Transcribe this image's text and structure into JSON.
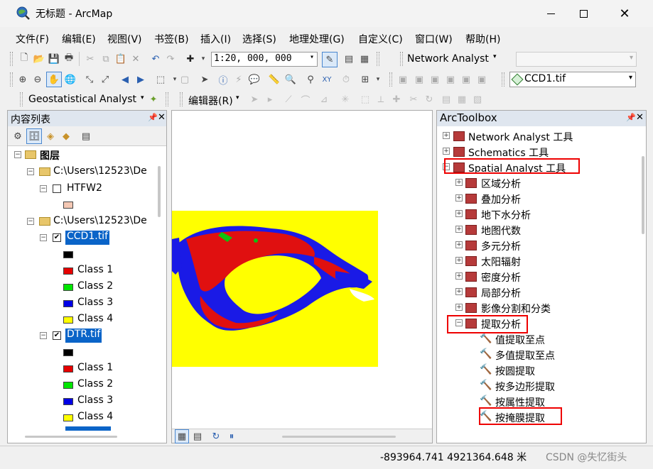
{
  "window": {
    "title": "无标题 - ArcMap",
    "min_icon": "minimize-icon",
    "max_icon": "maximize-icon",
    "close_icon": "close-icon"
  },
  "menu": [
    "文件(F)",
    "编辑(E)",
    "视图(V)",
    "书签(B)",
    "插入(I)",
    "选择(S)",
    "地理处理(G)",
    "自定义(C)",
    "窗口(W)",
    "帮助(H)"
  ],
  "toolbar": {
    "scale": "1:20, 000, 000",
    "network_analyst": "Network Analyst",
    "layer_select": "CCD1.tif",
    "geostat": "Geostatistical Analyst",
    "editor": "编辑器(R)"
  },
  "toc": {
    "title": "内容列表",
    "root": "图层",
    "groups": [
      {
        "label": "C:\\Users\\12523\\De",
        "layers": [
          {
            "name": "HTFW2",
            "checked": false,
            "legend": [
              {
                "color": "#f4c8b4",
                "label": ""
              }
            ]
          }
        ]
      },
      {
        "label": "C:\\Users\\12523\\De",
        "layers": [
          {
            "name": "CCD1.tif",
            "checked": true,
            "legend": [
              {
                "color": "#000000",
                "label": ""
              },
              {
                "color": "#e60000",
                "label": "Class 1"
              },
              {
                "color": "#00e600",
                "label": "Class 2"
              },
              {
                "color": "#0000e6",
                "label": "Class 3"
              },
              {
                "color": "#ffff00",
                "label": "Class 4"
              }
            ]
          },
          {
            "name": "DTR.tif",
            "checked": true,
            "legend": [
              {
                "color": "#000000",
                "label": ""
              },
              {
                "color": "#e60000",
                "label": "Class 1"
              },
              {
                "color": "#00e600",
                "label": "Class 2"
              },
              {
                "color": "#0000e6",
                "label": "Class 3"
              },
              {
                "color": "#ffff00",
                "label": "Class 4"
              }
            ]
          }
        ]
      }
    ]
  },
  "arctoolbox": {
    "title": "ArcToolbox",
    "toolboxes": [
      "Network Analyst 工具",
      "Schematics 工具",
      "Spatial Analyst 工具"
    ],
    "spatial_children": [
      "区域分析",
      "叠加分析",
      "地下水分析",
      "地图代数",
      "多元分析",
      "太阳辐射",
      "密度分析",
      "局部分析",
      "影像分割和分类",
      "提取分析"
    ],
    "extract_tools": [
      "值提取至点",
      "多值提取至点",
      "按圆提取",
      "按多边形提取",
      "按属性提取",
      "按掩膜提取"
    ]
  },
  "status": {
    "coords": "-893964.741  4921364.648 米",
    "watermark": "CSDN @失忆街头"
  },
  "colors": {
    "highlight": "#0a64c8",
    "annotation": "#e00000",
    "map_yellow": "#ffff00"
  }
}
